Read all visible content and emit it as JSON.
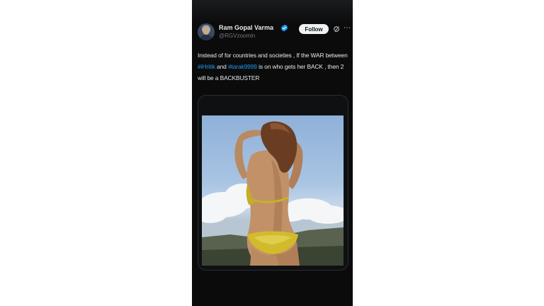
{
  "tweet": {
    "author_name": "Ram Gopal Varma",
    "author_handle": "@RGVzoomin",
    "follow_label": "Follow",
    "text": {
      "part1": "Instead of for countries and societies , If the WAR between ",
      "hashtag1": "#iHritik",
      "part2": " and ",
      "hashtag2": "#tarak9999",
      "part3": " is on who gets her BACK  , then 2 will be a BACKBUSTER"
    }
  },
  "icons": [
    "avatar",
    "verified-badge-icon",
    "grok-icon",
    "more-icon"
  ],
  "colors": {
    "background": "#0b0b0c",
    "text": "#e7e9ea",
    "muted": "#71767b",
    "link": "#1d9bf0",
    "verified": "#1d9bf0",
    "follow_bg": "#eff3f4"
  }
}
